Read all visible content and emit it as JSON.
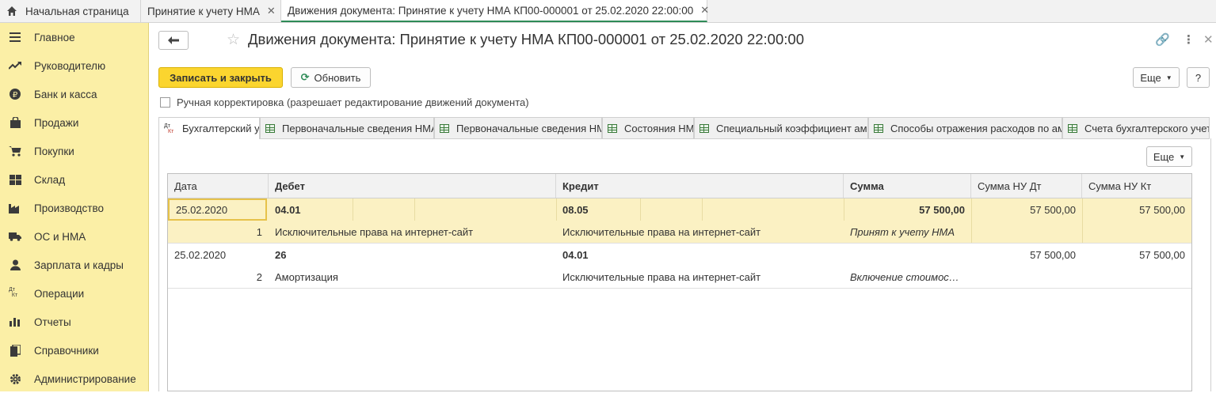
{
  "top_tabs": [
    {
      "label": "Начальная страница"
    },
    {
      "label": "Принятие к учету НМА"
    },
    {
      "label": "Движения документа: Принятие к учету НМА КП00-000001 от 25.02.2020 22:00:00"
    }
  ],
  "sidebar": {
    "items": [
      {
        "label": "Главное",
        "icon": "menu-icon"
      },
      {
        "label": "Руководителю",
        "icon": "trend-icon"
      },
      {
        "label": "Банк и касса",
        "icon": "ruble-icon"
      },
      {
        "label": "Продажи",
        "icon": "bag-icon"
      },
      {
        "label": "Покупки",
        "icon": "cart-icon"
      },
      {
        "label": "Склад",
        "icon": "warehouse-icon"
      },
      {
        "label": "Производство",
        "icon": "factory-icon"
      },
      {
        "label": "ОС и НМА",
        "icon": "truck-icon"
      },
      {
        "label": "Зарплата и кадры",
        "icon": "person-icon"
      },
      {
        "label": "Операции",
        "icon": "dt-kt-icon"
      },
      {
        "label": "Отчеты",
        "icon": "bar-chart-icon"
      },
      {
        "label": "Справочники",
        "icon": "books-icon"
      },
      {
        "label": "Администрирование",
        "icon": "gear-icon"
      }
    ]
  },
  "header": {
    "title": "Движения документа: Принятие к учету НМА КП00-000001 от 25.02.2020 22:00:00"
  },
  "toolbar": {
    "save_close_label": "Записать и закрыть",
    "refresh_label": "Обновить",
    "more_label": "Еще",
    "help_label": "?"
  },
  "manual_correction": {
    "label": "Ручная корректировка (разрешает редактирование движений документа)",
    "checked": false
  },
  "sub_tabs": [
    {
      "label": "Бухгалтерский учет"
    },
    {
      "label": "Первоначальные сведения НМА (бухгалтерский и налоговый учет)"
    },
    {
      "label": "Первоначальные сведения НМА"
    },
    {
      "label": "Состояния НМА"
    },
    {
      "label": "Специальный коэффициент амортизации"
    },
    {
      "label": "Способы отражения расходов по амортизации"
    },
    {
      "label": "Счета бухгалтерского учета НМА"
    }
  ],
  "table": {
    "more_label": "Еще",
    "columns": [
      "Дата",
      "Дебет",
      "Кредит",
      "Сумма",
      "Сумма НУ Дт",
      "Сумма НУ Кт"
    ],
    "records": [
      {
        "date": "25.02.2020",
        "num": "1",
        "debit": "04.01",
        "debit_sub": "Исключительные права на интернет-сайт",
        "credit": "08.05",
        "credit_sub": "Исключительные права на интернет-сайт",
        "sum": "57 500,00",
        "content": "Принят к учету НМА",
        "nu_dt": "57 500,00",
        "nu_kt": "57 500,00"
      },
      {
        "date": "25.02.2020",
        "num": "2",
        "debit": "26",
        "debit_sub": "Амортизация",
        "credit": "04.01",
        "credit_sub": "Исключительные права на интернет-сайт",
        "sum": "",
        "content": "Включение стоимос…",
        "nu_dt": "57 500,00",
        "nu_kt": "57 500,00"
      }
    ]
  }
}
